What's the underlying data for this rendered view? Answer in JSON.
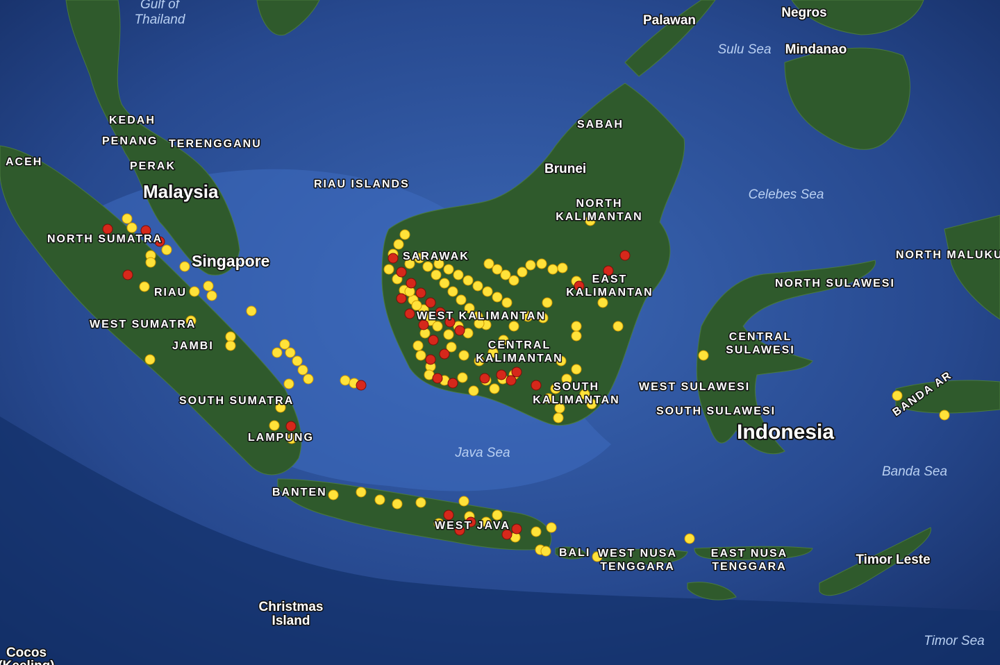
{
  "map": {
    "labels": {
      "gulf_of_thailand": "Gulf of\nThailand",
      "palawan": "Palawan",
      "negros": "Negros",
      "sulu_sea": "Sulu Sea",
      "mindanao": "Mindanao",
      "kedah": "KEDAH",
      "penang": "PENANG",
      "terengganu": "TERENGGANU",
      "aceh": "ACEH",
      "perak": "PERAK",
      "malaysia": "Malaysia",
      "sabah": "SABAH",
      "brunei": "Brunei",
      "riau_islands": "RIAU ISLANDS",
      "north_kalimantan": "NORTH\nKALIMANTAN",
      "celebes_sea": "Celebes Sea",
      "north_sumatra": "NORTH SUMATRA",
      "singapore": "Singapore",
      "sarawak": "SARAWAK",
      "north_maluku": "NORTH MALUKU",
      "east_kalimantan": "EAST\nKALIMANTAN",
      "north_sulawesi": "NORTH SULAWESI",
      "riau": "RIAU",
      "west_kalimantan": "WEST KALIMANTAN",
      "west_sumatra": "WEST SUMATRA",
      "central_sulawesi": "CENTRAL\nSULAWESI",
      "jambi": "JAMBI",
      "central_kalimantan": "CENTRAL\nKALIMANTAN",
      "banda_arc": "BANDA AR",
      "south_kalimantan": "SOUTH\nKALIMANTAN",
      "west_sulawesi": "WEST SULAWESI",
      "south_sumatra": "SOUTH SUMATRA",
      "south_sulawesi": "SOUTH SULAWESI",
      "indonesia": "Indonesia",
      "lampung": "LAMPUNG",
      "java_sea": "Java Sea",
      "banda_sea": "Banda Sea",
      "banten": "BANTEN",
      "west_java": "WEST JAVA",
      "bali": "BALI",
      "west_nusa_tenggara": "WEST NUSA\nTENGGARA",
      "east_nusa_tenggara": "EAST NUSA\nTENGGARA",
      "timor_leste": "Timor Leste",
      "christmas_island": "Christmas\nIsland",
      "timor_sea": "Timor Sea",
      "cocos": "Cocos\n(Keeling)"
    },
    "colors": {
      "ocean_deep": "#12306a",
      "ocean_shelf": "#3a66b8",
      "land": "#2f5a2c",
      "fire_red": "#d6281b",
      "fire_yellow": "#ffe23a"
    },
    "marker_legend": {
      "red": "fire-hotspot-high",
      "yellow": "fire-hotspot"
    }
  }
}
